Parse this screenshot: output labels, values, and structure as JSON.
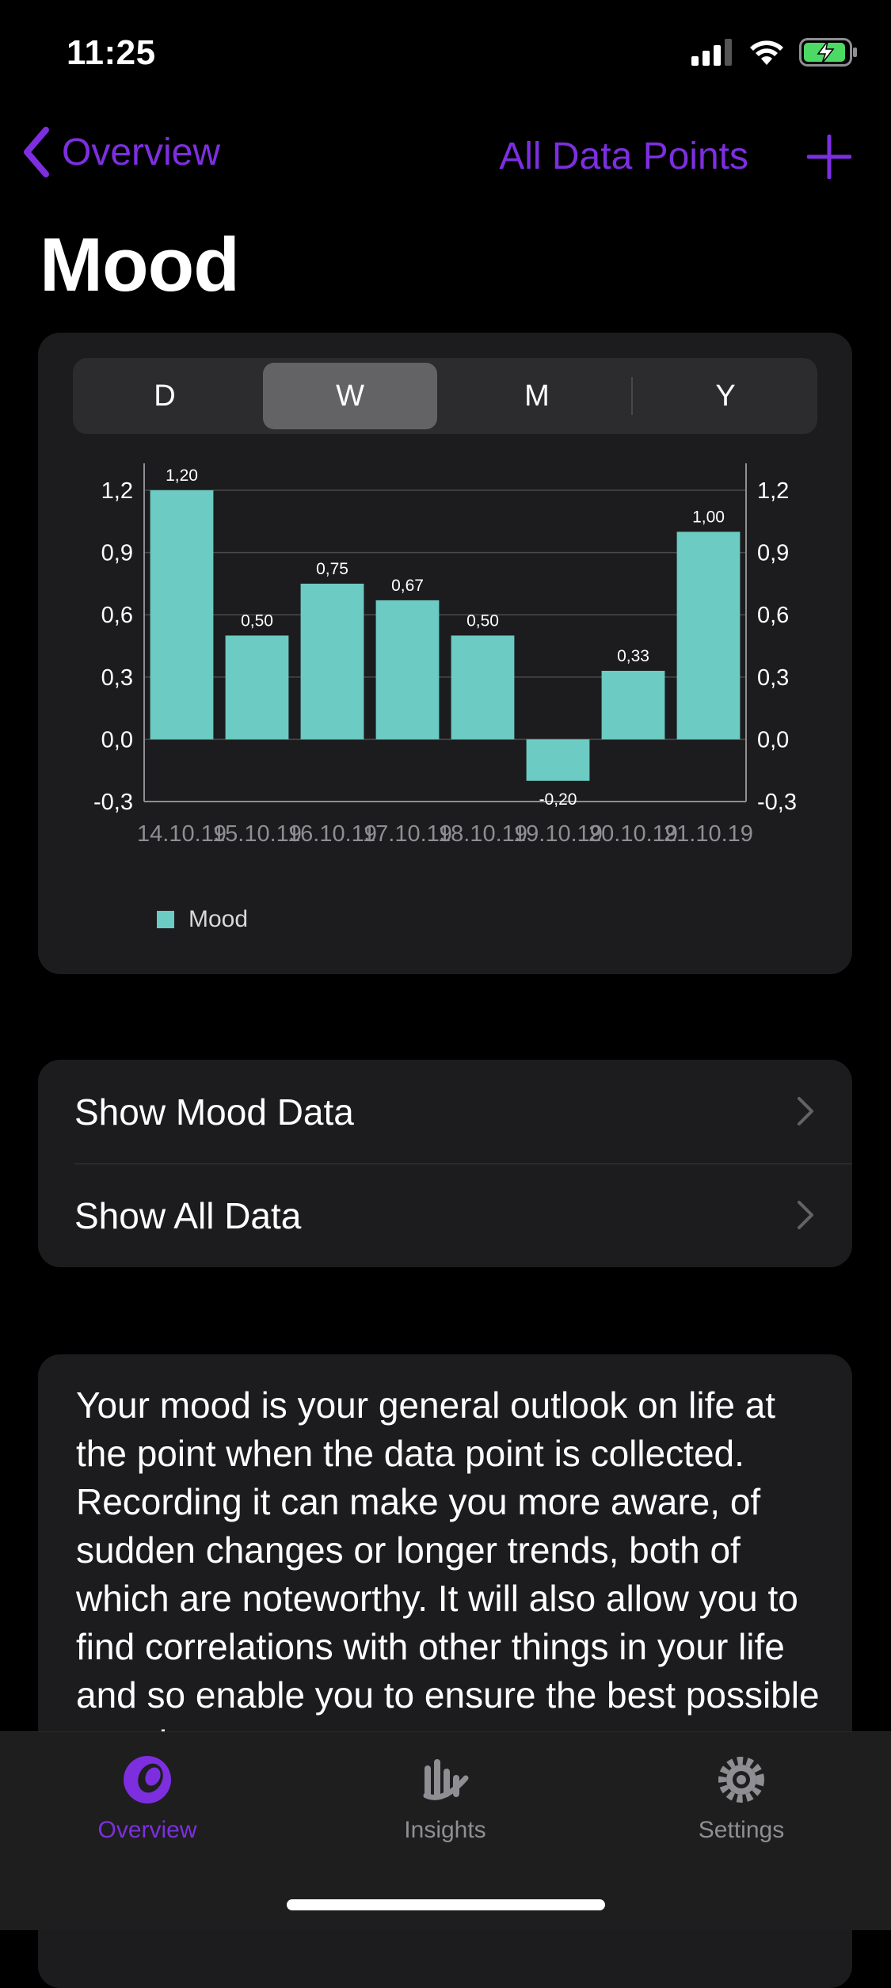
{
  "status": {
    "time": "11:25"
  },
  "nav": {
    "back_label": "Overview",
    "all_points_label": "All Data Points"
  },
  "page": {
    "title": "Mood"
  },
  "segments": [
    "D",
    "W",
    "M",
    "Y"
  ],
  "selected_segment": "W",
  "chart_data": {
    "type": "bar",
    "categories": [
      "14.10.19",
      "15.10.19",
      "16.10.19",
      "17.10.19",
      "18.10.19",
      "19.10.19",
      "20.10.19",
      "21.10.19"
    ],
    "values": [
      1.2,
      0.5,
      0.75,
      0.67,
      0.5,
      -0.2,
      0.33,
      1.0
    ],
    "value_labels": [
      "1,20",
      "0,50",
      "0,75",
      "0,67",
      "0,50",
      "-0,20",
      "0,33",
      "1,00"
    ],
    "yticks": [
      "-0,3",
      "0,0",
      "0,3",
      "0,6",
      "0,9",
      "1,2"
    ],
    "ylim": [
      -0.3,
      1.33
    ],
    "series": [
      {
        "name": "Mood"
      }
    ],
    "color": "#6ccbc2",
    "grid": true,
    "legend": "bottom-left"
  },
  "links": [
    {
      "label": "Show Mood Data"
    },
    {
      "label": "Show All Data"
    }
  ],
  "description": "Your mood is your general outlook on life at the point when the data point is collected. Recording it can make you more aware, of sudden changes or longer trends, both of which are noteworthy. It will also allow you to find correlations with other things in your life and so enable you to ensure the best possible mood",
  "tabs": [
    {
      "label": "Overview",
      "icon": "overview-icon",
      "active": true
    },
    {
      "label": "Insights",
      "icon": "insights-icon",
      "active": false
    },
    {
      "label": "Settings",
      "icon": "settings-icon",
      "active": false
    }
  ],
  "colors": {
    "accent": "#7d2fe0",
    "bar": "#6ccbc2",
    "tab_inactive": "#8e8e93"
  }
}
